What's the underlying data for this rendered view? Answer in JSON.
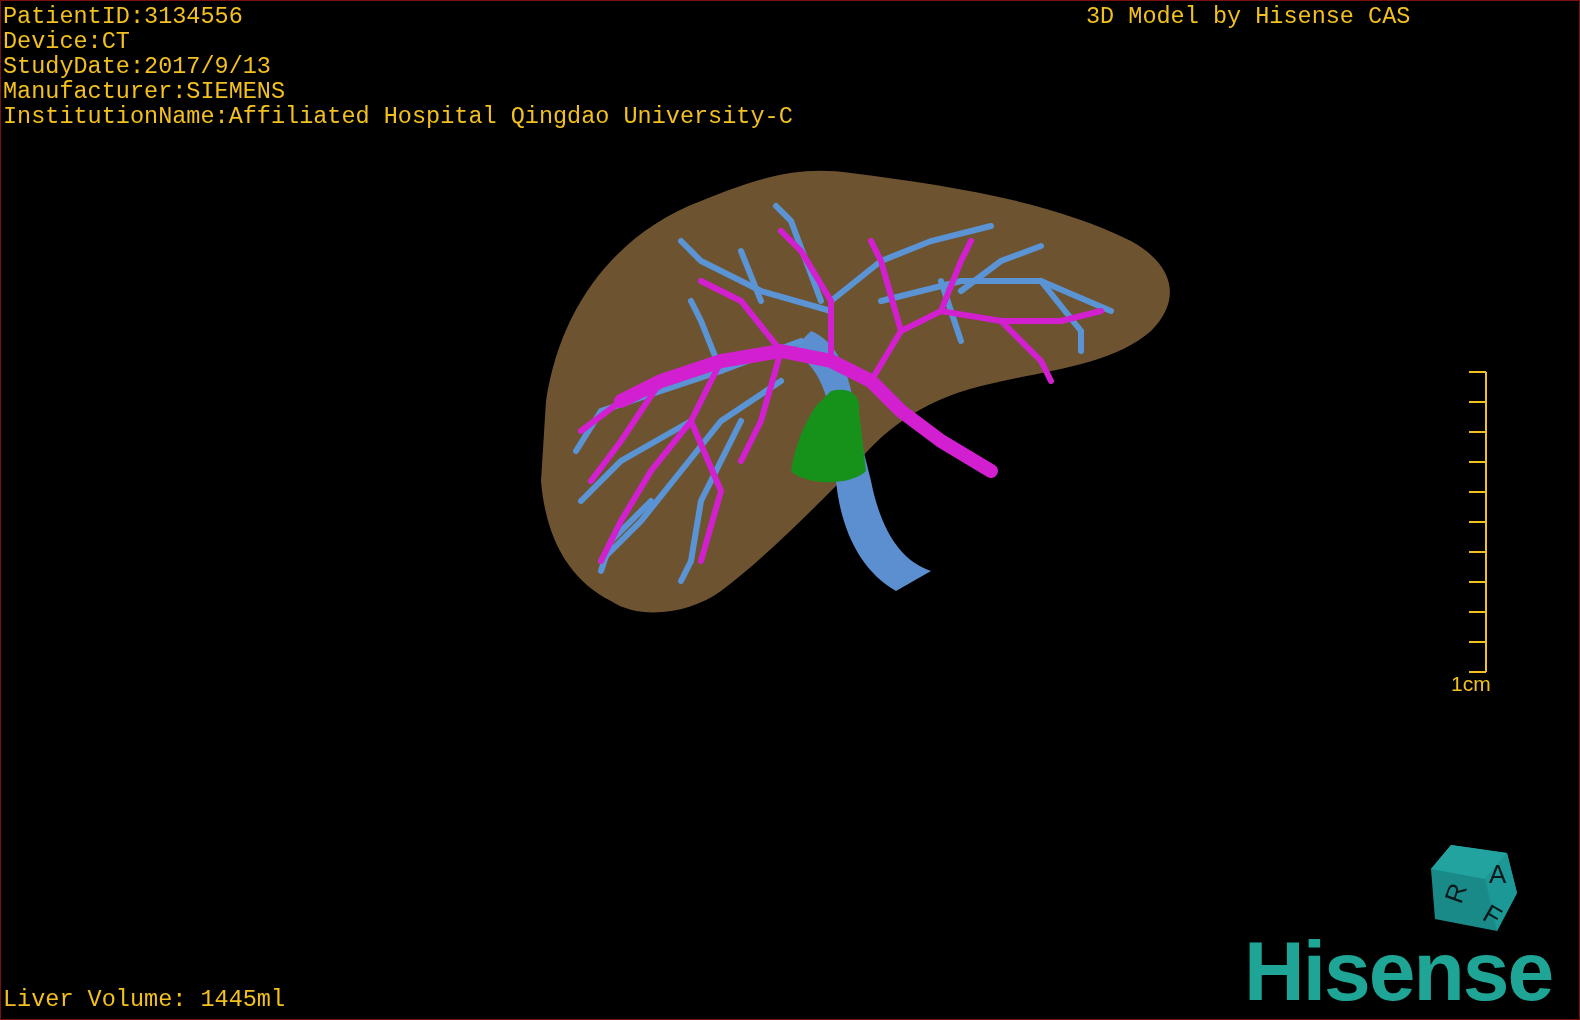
{
  "patient_info": [
    "PatientID:3134556",
    "Device:CT",
    "StudyDate:2017/9/13",
    "Manufacturer:SIEMENS",
    "InstitutionName:Affiliated Hospital Qingdao University-C"
  ],
  "title": "3D Model by Hisense CAS",
  "scale_bar": {
    "label": "1cm"
  },
  "orientation_cube": {
    "faces": [
      "A",
      "R",
      "F"
    ]
  },
  "logo": {
    "text": "Hisense"
  },
  "liver_volume": "Liver Volume: 1445ml"
}
